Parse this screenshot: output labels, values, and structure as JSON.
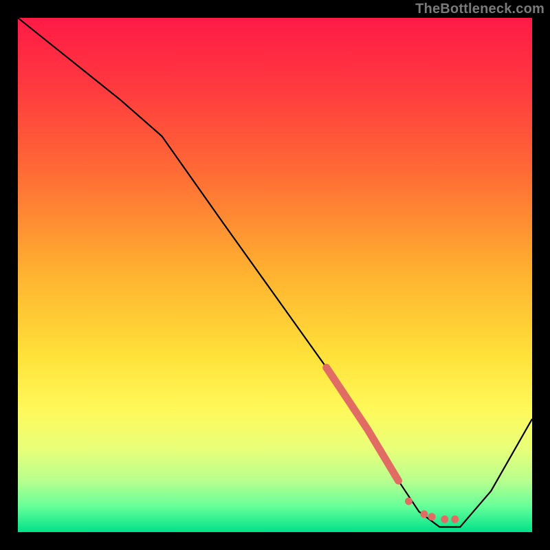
{
  "watermark": "TheBottleneck.com",
  "chart_data": {
    "type": "line",
    "title": "",
    "xlabel": "",
    "ylabel": "",
    "xlim": [
      0,
      100
    ],
    "ylim": [
      0,
      100
    ],
    "gradient_stops": [
      {
        "offset": 0,
        "color": "#ff1a46"
      },
      {
        "offset": 14,
        "color": "#ff3b3f"
      },
      {
        "offset": 30,
        "color": "#ff6b35"
      },
      {
        "offset": 50,
        "color": "#ffb330"
      },
      {
        "offset": 66,
        "color": "#ffe23a"
      },
      {
        "offset": 76,
        "color": "#fff95a"
      },
      {
        "offset": 84,
        "color": "#e8ff7a"
      },
      {
        "offset": 90,
        "color": "#b8ff8e"
      },
      {
        "offset": 95,
        "color": "#66ff99"
      },
      {
        "offset": 100,
        "color": "#00e18a"
      }
    ],
    "series": [
      {
        "name": "bottleneck-curve",
        "x": [
          0,
          10,
          20,
          28,
          40,
          50,
          60,
          68,
          74,
          78,
          82,
          86,
          92,
          100
        ],
        "y": [
          100,
          92,
          84,
          77,
          60,
          46,
          32,
          20,
          10,
          4,
          1,
          1,
          8,
          22
        ]
      }
    ],
    "highlight_segment": {
      "name": "salmon-stroke",
      "x": [
        60,
        68,
        74
      ],
      "y": [
        32,
        20,
        10
      ],
      "color": "#e06c63",
      "width": 11
    },
    "highlight_dots": {
      "name": "salmon-dots",
      "points": [
        {
          "x": 76,
          "y": 6
        },
        {
          "x": 79,
          "y": 3.5
        },
        {
          "x": 80.5,
          "y": 3
        },
        {
          "x": 83,
          "y": 2.5
        },
        {
          "x": 85,
          "y": 2.5
        }
      ],
      "color": "#e06c63",
      "r": 5.5
    }
  }
}
